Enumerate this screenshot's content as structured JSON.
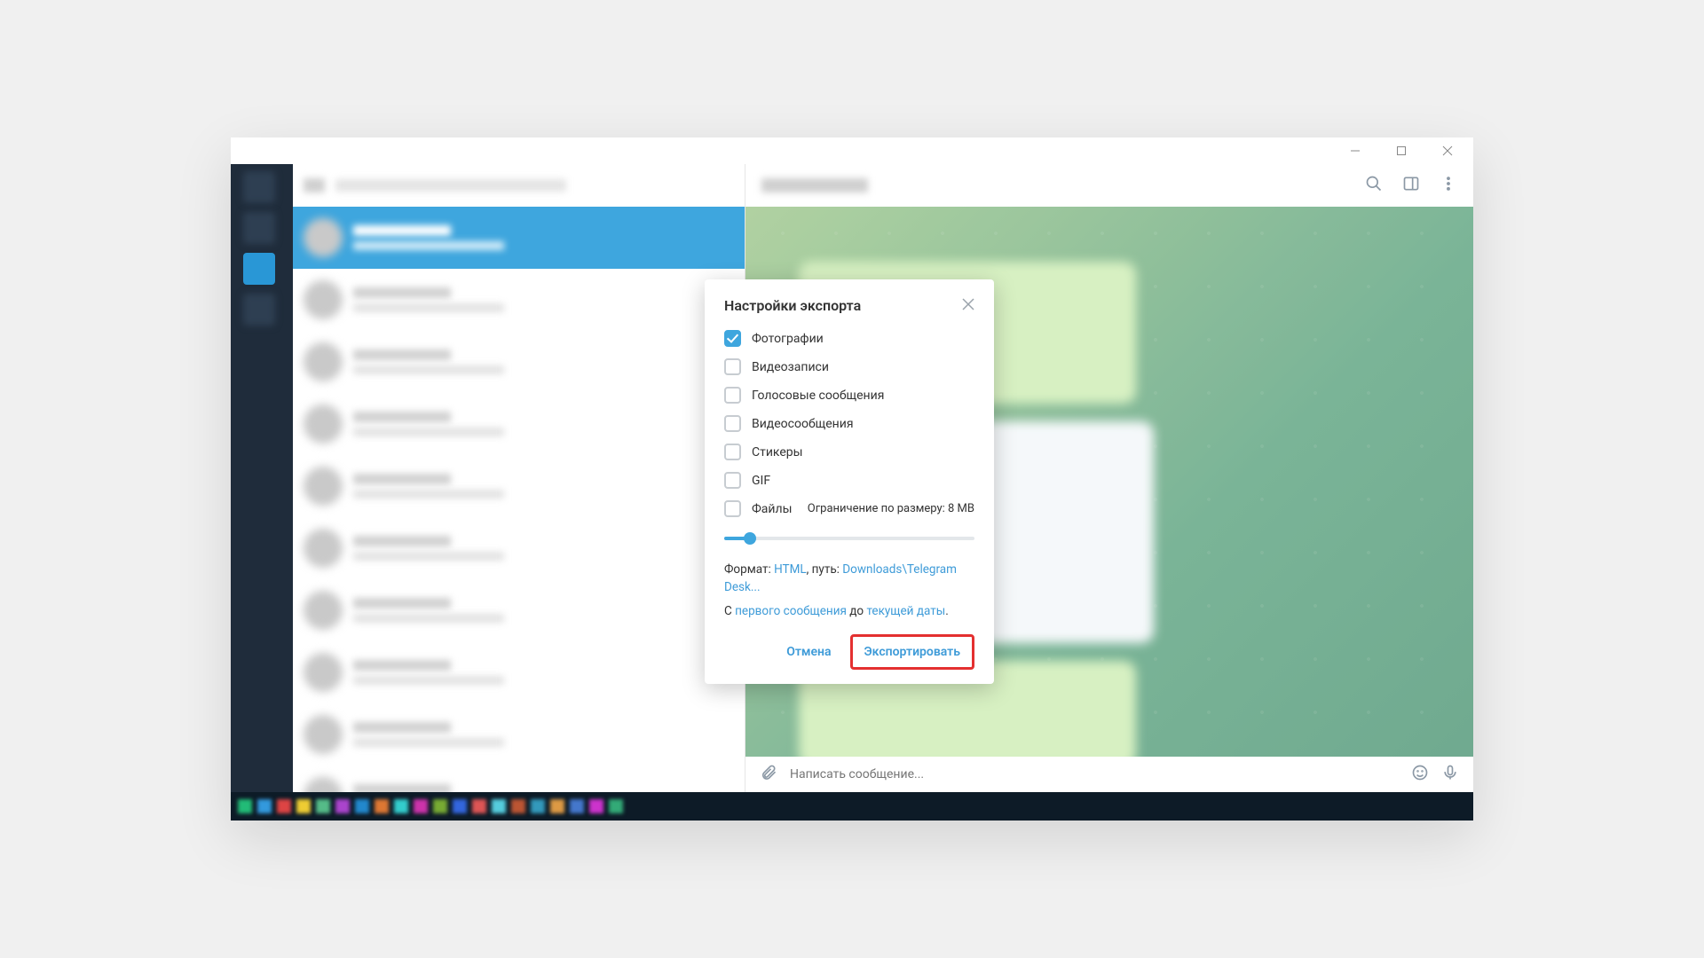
{
  "titlebar": {
    "min": "—",
    "max": "□",
    "close": "×"
  },
  "header": {
    "icons": [
      "search-icon",
      "sidepanel-icon",
      "more-icon"
    ]
  },
  "dialog": {
    "title": "Настройки экспорта",
    "options": [
      {
        "label": "Фотографии",
        "checked": true
      },
      {
        "label": "Видеозаписи",
        "checked": false
      },
      {
        "label": "Голосовые сообщения",
        "checked": false
      },
      {
        "label": "Видеосообщения",
        "checked": false
      },
      {
        "label": "Стикеры",
        "checked": false
      },
      {
        "label": "GIF",
        "checked": false
      },
      {
        "label": "Файлы",
        "checked": false
      }
    ],
    "size_limit_label": "Ограничение по размеру: 8 MB",
    "format_line": {
      "prefix": "Формат: ",
      "format_link": "HTML",
      "mid": ", путь: ",
      "path_link": "Downloads\\Telegram Desk..."
    },
    "range_line": {
      "prefix": "С ",
      "from_link": "первого сообщения",
      "mid": " до ",
      "to_link": "текущей даты",
      "suffix": "."
    },
    "cancel": "Отмена",
    "export": "Экспортировать"
  },
  "message_input": {
    "placeholder": "Написать сообщение..."
  }
}
